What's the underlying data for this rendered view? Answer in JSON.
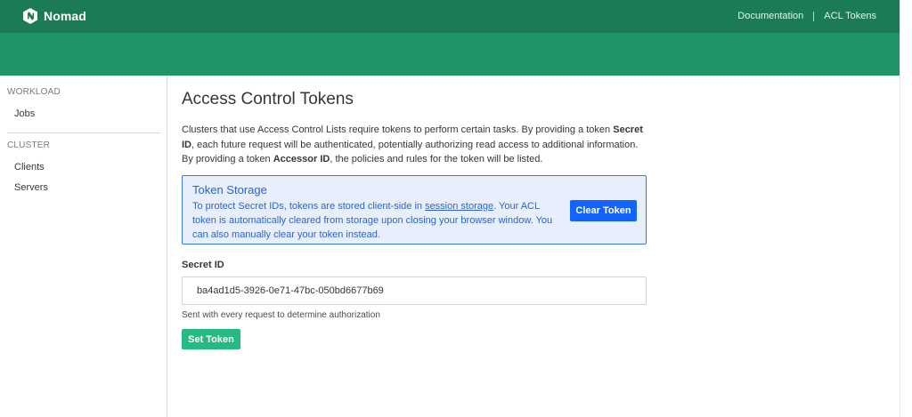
{
  "header": {
    "brand": "Nomad",
    "links": [
      {
        "label": "Documentation"
      },
      {
        "label": "ACL Tokens"
      }
    ]
  },
  "sidebar": {
    "sections": [
      {
        "heading": "WORKLOAD",
        "items": [
          {
            "label": "Jobs"
          }
        ]
      },
      {
        "heading": "CLUSTER",
        "items": [
          {
            "label": "Clients"
          },
          {
            "label": "Servers"
          }
        ]
      }
    ]
  },
  "main": {
    "title": "Access Control Tokens",
    "intro": {
      "part1": "Clusters that use Access Control Lists require tokens to perform certain tasks. By providing a token ",
      "bold1": "Secret ID",
      "part2": ", each future request will be authenticated, potentially authorizing read access to additional information. By providing a token ",
      "bold2": "Accessor ID",
      "part3": ", the policies and rules for the token will be listed."
    },
    "notice": {
      "title": "Token Storage",
      "body_before": "To protect Secret IDs, tokens are stored client-side in ",
      "link": "session storage",
      "body_after": ". Your ACL token is automatically cleared from storage upon closing your browser window. You can also manually clear your token instead.",
      "button": "Clear Token"
    },
    "secret_field": {
      "label": "Secret ID",
      "value": "ba4ad1d5-3926-0e71-47bc-050bd6677b69",
      "help": "Sent with every request to determine authorization"
    },
    "set_button": "Set Token"
  },
  "colors": {
    "header_dark": "#1a7b54",
    "header_light": "#1f9467",
    "info_blue": "#1563ff",
    "success_green": "#25ba81"
  },
  "icons": {
    "brand": "nomad-logo-icon"
  }
}
